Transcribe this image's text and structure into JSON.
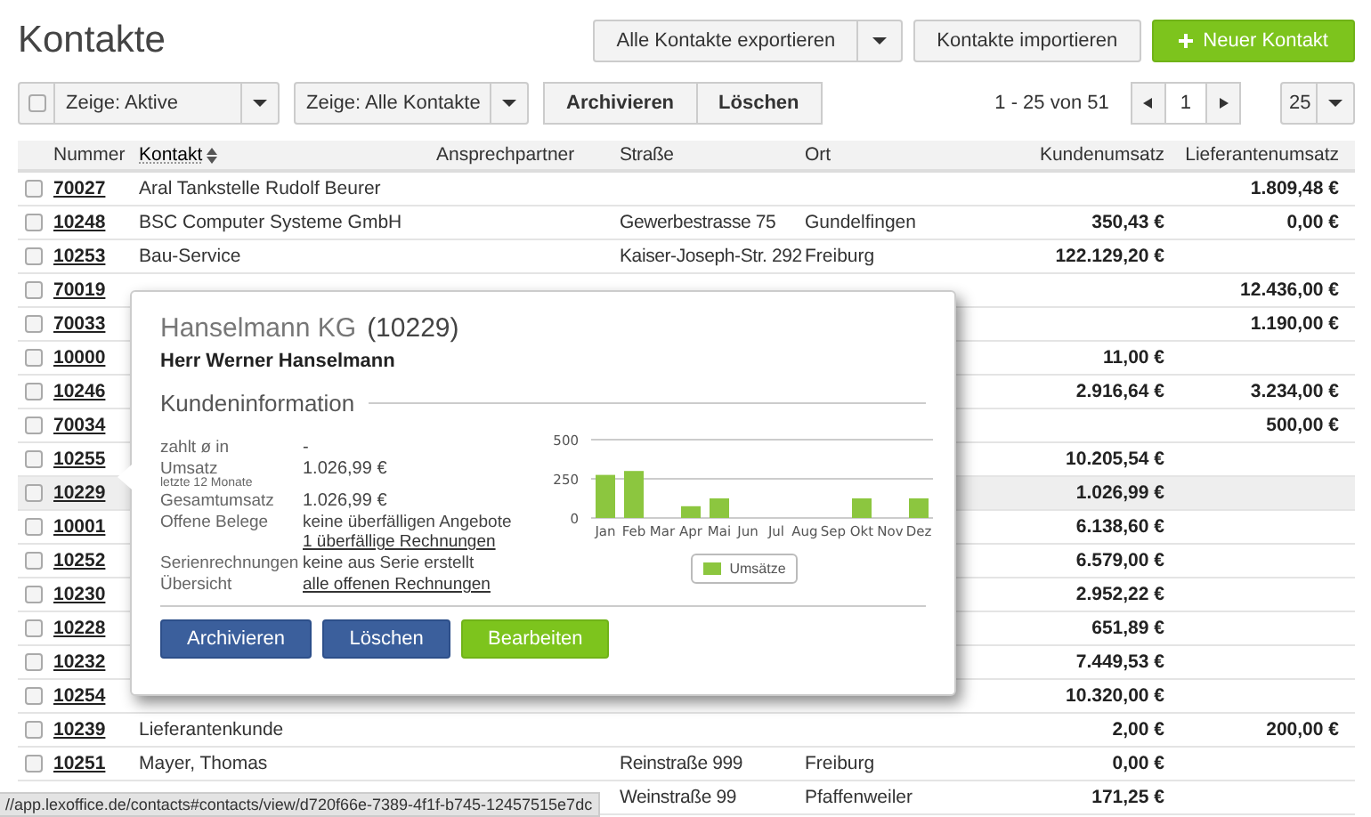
{
  "page_title": "Kontakte",
  "header_buttons": [
    {
      "label": "Alle Kontakte exportieren",
      "kind": "split"
    },
    {
      "label": "Kontakte importieren",
      "kind": "default"
    },
    {
      "label": "Neuer Kontakt",
      "kind": "primary"
    }
  ],
  "toolbar": {
    "select_all": {
      "checked": false
    },
    "filters": [
      "Zeige: Aktive",
      "Zeige: Alle Kontakte"
    ],
    "actions": [
      "Archivieren",
      "Löschen"
    ],
    "range": "1 - 25 von 51",
    "page": "1",
    "page_size": "25"
  },
  "table": {
    "columns": [
      {
        "label": "Nummer",
        "sorted": false
      },
      {
        "label": "Kontakt",
        "sorted": true
      },
      {
        "label": "Ansprechpartner",
        "sorted": false
      },
      {
        "label": "Straße",
        "sorted": false
      },
      {
        "label": "Ort",
        "sorted": false
      },
      {
        "label": "Kundenumsatz",
        "sorted": false
      },
      {
        "label": "Lieferantenumsatz",
        "sorted": false
      }
    ],
    "rows": [
      {
        "checked": false,
        "highlighted": false,
        "number": "70027",
        "contact": "Aral Tankstelle Rudolf Beurer",
        "supplier_sales": "1.809,48 €"
      },
      {
        "checked": false,
        "highlighted": false,
        "number": "10248",
        "contact": "BSC Computer Systeme GmbH",
        "street": "Gewerbestrasse 75",
        "city": "Gundelfingen",
        "customer_sales": "350,43 €",
        "supplier_sales": "0,00 €"
      },
      {
        "checked": false,
        "highlighted": false,
        "number": "10253",
        "contact": "Bau-Service",
        "street": "Kaiser-Joseph-Str. 292",
        "city": "Freiburg",
        "customer_sales": "122.129,20 €"
      },
      {
        "checked": false,
        "highlighted": false,
        "number": "70019",
        "supplier_sales": "12.436,00 €"
      },
      {
        "checked": false,
        "highlighted": false,
        "number": "70033",
        "supplier_sales": "1.190,00 €"
      },
      {
        "checked": false,
        "highlighted": false,
        "number": "10000",
        "customer_sales": "11,00 €"
      },
      {
        "checked": false,
        "highlighted": false,
        "number": "10246",
        "customer_sales": "2.916,64 €",
        "supplier_sales": "3.234,00 €"
      },
      {
        "checked": false,
        "highlighted": false,
        "number": "70034",
        "supplier_sales": "500,00 €"
      },
      {
        "checked": false,
        "highlighted": false,
        "number": "10255",
        "customer_sales": "10.205,54 €"
      },
      {
        "checked": false,
        "highlighted": true,
        "number": "10229",
        "customer_sales": "1.026,99 €"
      },
      {
        "checked": false,
        "highlighted": false,
        "number": "10001",
        "customer_sales": "6.138,60 €"
      },
      {
        "checked": false,
        "highlighted": false,
        "number": "10252",
        "customer_sales": "6.579,00 €"
      },
      {
        "checked": false,
        "highlighted": false,
        "number": "10230",
        "customer_sales": "2.952,22 €"
      },
      {
        "checked": false,
        "highlighted": false,
        "number": "10228",
        "customer_sales": "651,89 €"
      },
      {
        "checked": false,
        "highlighted": false,
        "number": "10232",
        "customer_sales": "7.449,53 €"
      },
      {
        "checked": false,
        "highlighted": false,
        "number": "10254",
        "customer_sales": "10.320,00 €"
      },
      {
        "checked": false,
        "highlighted": false,
        "number": "10239",
        "contact": "Lieferantenkunde",
        "customer_sales": "2,00 €",
        "supplier_sales": "200,00 €"
      },
      {
        "checked": false,
        "highlighted": false,
        "number": "10251",
        "contact": "Mayer, Thomas",
        "street": "Reinstraße 999",
        "city": "Freiburg",
        "customer_sales": "0,00 €"
      },
      {
        "highlighted": false,
        "street": "Weinstraße 99",
        "city": "Pfaffenweiler",
        "customer_sales": "171,25 €"
      }
    ]
  },
  "popup": {
    "company": "Hanselmann KG",
    "number": "(10229)",
    "person": "Herr Werner Hanselmann",
    "section": "Kundeninformation",
    "fields": [
      {
        "label": "zahlt ø in",
        "values": [
          {
            "text": "-",
            "kind": "text"
          }
        ]
      },
      {
        "label": "Umsatz",
        "sublabel": "letzte 12 Monate",
        "values": [
          {
            "text": "1.026,99 €",
            "kind": "text"
          }
        ]
      },
      {
        "label": "Gesamtumsatz",
        "values": [
          {
            "text": "1.026,99 €",
            "kind": "text"
          }
        ]
      },
      {
        "label": "Offene Belege",
        "values": [
          {
            "text": "keine überfälligen Angebote",
            "kind": "text"
          },
          {
            "text": "1 überfällige Rechnungen",
            "kind": "link"
          }
        ]
      },
      {
        "label": "Serienrechnungen",
        "values": [
          {
            "text": "keine aus Serie erstellt",
            "kind": "text"
          }
        ]
      },
      {
        "label": "Übersicht",
        "values": [
          {
            "text": "alle offenen Rechnungen",
            "kind": "link"
          }
        ]
      }
    ],
    "chart_data": {
      "type": "bar",
      "categories": [
        "Jan",
        "Feb",
        "Mar",
        "Apr",
        "Mai",
        "Jun",
        "Jul",
        "Aug",
        "Sep",
        "Okt",
        "Nov",
        "Dez"
      ],
      "series": [
        {
          "name": "Umsätze",
          "color": "#8cc63f",
          "values": [
            275,
            300,
            0,
            75,
            125,
            0,
            0,
            0,
            0,
            125,
            0,
            125
          ]
        }
      ],
      "ylim": [
        0,
        500
      ],
      "yticks": [
        0,
        250,
        500
      ]
    },
    "buttons": [
      {
        "label": "Archivieren",
        "kind": "blue"
      },
      {
        "label": "Löschen",
        "kind": "blue"
      },
      {
        "label": "Bearbeiten",
        "kind": "green"
      }
    ]
  },
  "status_bar": "//app.lexoffice.de/contacts#contacts/view/d720f66e-7389-4f1f-b745-12457515e7dc"
}
